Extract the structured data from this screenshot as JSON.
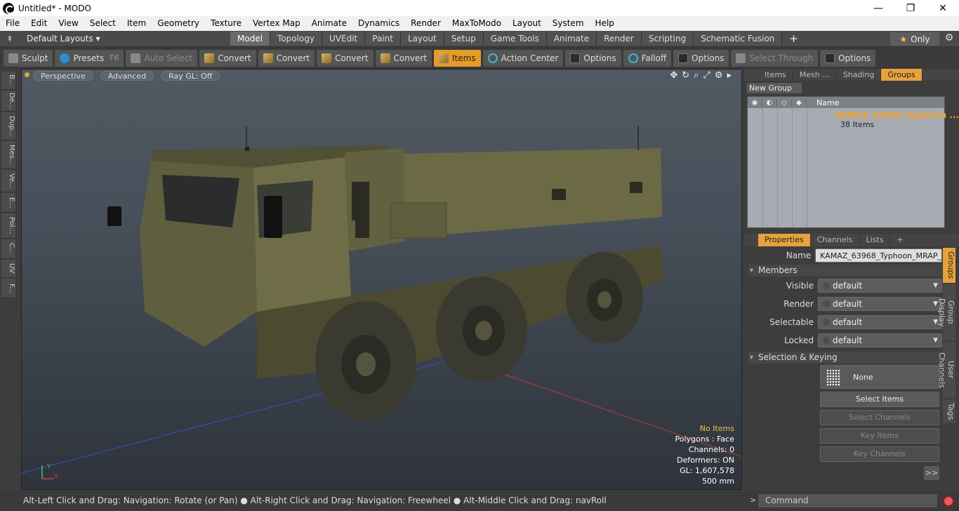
{
  "window": {
    "title": "Untitled* - MODO",
    "min": "—",
    "max": "❐",
    "close": "✕"
  },
  "menu": [
    "File",
    "Edit",
    "View",
    "Select",
    "Item",
    "Geometry",
    "Texture",
    "Vertex Map",
    "Animate",
    "Dynamics",
    "Render",
    "MaxToModo",
    "Layout",
    "System",
    "Help"
  ],
  "layouts": {
    "label": "Default Layouts ▾",
    "up_icon": "⇞"
  },
  "tabs": [
    {
      "label": "Model",
      "active": true
    },
    {
      "label": "Topology"
    },
    {
      "label": "UVEdit"
    },
    {
      "label": "Paint"
    },
    {
      "label": "Layout"
    },
    {
      "label": "Setup"
    },
    {
      "label": "Game Tools"
    },
    {
      "label": "Animate"
    },
    {
      "label": "Render"
    },
    {
      "label": "Scripting"
    },
    {
      "label": "Schematic Fusion"
    }
  ],
  "tab_plus": "+",
  "only": {
    "star": "★",
    "label": "Only"
  },
  "gear": "⚙",
  "toolbar": {
    "sculpt": "Sculpt",
    "presets": "Presets",
    "presets_hint": "F6",
    "auto_select": "Auto Select",
    "convert1": "Convert",
    "convert2": "Convert",
    "convert3": "Convert",
    "convert4": "Convert",
    "items": "Items",
    "action_center": "Action Center",
    "options1": "Options",
    "falloff": "Falloff",
    "options2": "Options",
    "select_through": "Select Through",
    "options3": "Options"
  },
  "left_strip": [
    "B...",
    "De...",
    "Dup...",
    "Mes...",
    "Ve...",
    "E...",
    "Pol...",
    "C...",
    "UV",
    "F..."
  ],
  "viewport": {
    "perspective": "Perspective",
    "advanced": "Advanced",
    "raygl": "Ray GL: Off",
    "icons": [
      "✥",
      "↻",
      "⌕",
      "⤢",
      "⚙",
      "▸"
    ],
    "stats": {
      "items": "No Items",
      "polygons": "Polygons : Face",
      "channels": "Channels: 0",
      "deformers": "Deformers: ON",
      "gl": "GL: 1,607,578",
      "scale": "500 mm"
    },
    "axis_x": "X",
    "axis_y": "Y"
  },
  "groups_panel": {
    "tabs": [
      "Items",
      "Mesh ...",
      "Shading",
      "Groups"
    ],
    "active_tab": "Groups",
    "new_group": "New Group",
    "col_name": "Name",
    "group_name": "KAMAZ_63968_Typhoon ...",
    "group_count": "38 Items"
  },
  "props_panel": {
    "tabs": [
      "Properties",
      "Channels",
      "Lists"
    ],
    "plus": "+",
    "name_label": "Name",
    "name_value": "KAMAZ_63968_Typhoon_MRAP_",
    "members": "Members",
    "visible_label": "Visible",
    "visible_value": "default",
    "render_label": "Render",
    "render_value": "default",
    "selectable_label": "Selectable",
    "selectable_value": "default",
    "locked_label": "Locked",
    "locked_value": "default",
    "sel_keying": "Selection & Keying",
    "none": "None",
    "select_items": "Select Items",
    "select_channels": "Select Channels",
    "key_items": "Key Items",
    "key_channels": "Key Channels",
    "more": ">>"
  },
  "side_tabs": [
    "Groups",
    "Group Display",
    "User Channels",
    "Tags"
  ],
  "status": "Alt-Left Click and Drag: Navigation: Rotate (or Pan) ● Alt-Right Click and Drag: Navigation: Freewheel ● Alt-Middle Click and Drag: navRoll",
  "command": {
    "gt": ">",
    "placeholder": "Command"
  },
  "colors": {
    "accent": "#e6a23c",
    "vehicle": "#6b6a44",
    "viewport_top": "#515963"
  }
}
